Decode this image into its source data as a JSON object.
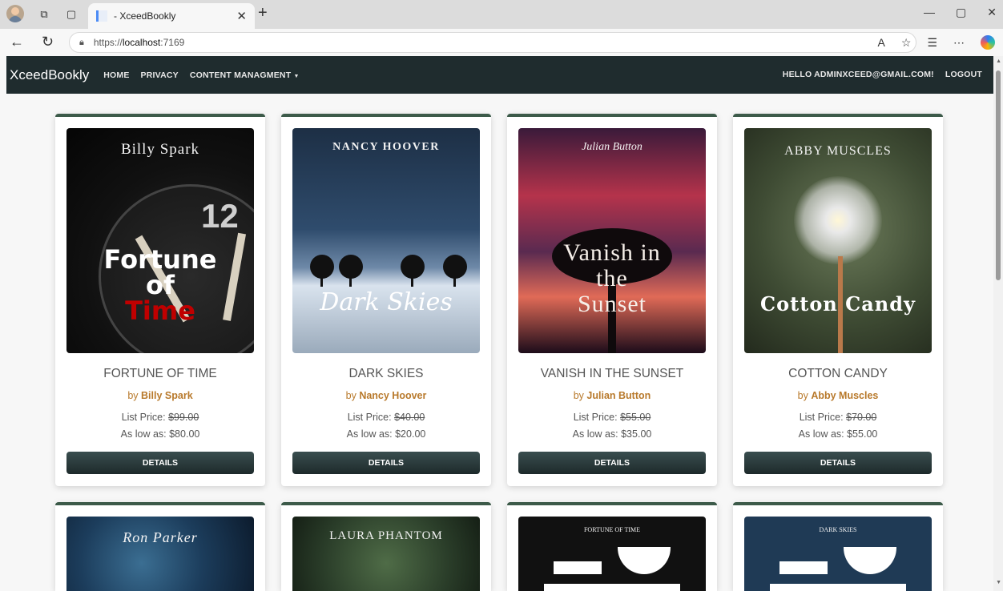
{
  "browser": {
    "tab_title": "- XceedBookly",
    "url_scheme": "https://",
    "url_host": "localhost",
    "url_port": ":7169"
  },
  "navbar": {
    "brand": "XceedBookly",
    "links": [
      "HOME",
      "PRIVACY",
      "CONTENT MANAGMENT"
    ],
    "greeting": "HELLO ADMINXCEED@GMAIL.COM!",
    "logout": "LOGOUT"
  },
  "ui": {
    "by": "by",
    "list_price_label": "List Price:",
    "as_low_as_label": "As low as:",
    "details": "DETAILS"
  },
  "books": [
    {
      "title": "FORTUNE OF TIME",
      "author": "Billy Spark",
      "list_price": "$99.00",
      "low_price": "$80.00",
      "cover_author": "Billy Spark",
      "cover_title_lines": [
        "Fortune",
        "of",
        "Time"
      ]
    },
    {
      "title": "DARK SKIES",
      "author": "Nancy Hoover",
      "list_price": "$40.00",
      "low_price": "$20.00",
      "cover_author": "NANCY HOOVER",
      "cover_title_lines": [
        "Dark Skies"
      ]
    },
    {
      "title": "VANISH IN THE SUNSET",
      "author": "Julian Button",
      "list_price": "$55.00",
      "low_price": "$35.00",
      "cover_author": "Julian Button",
      "cover_title_lines": [
        "Vanish in",
        "the",
        "Sunset"
      ]
    },
    {
      "title": "COTTON CANDY",
      "author": "Abby Muscles",
      "list_price": "$70.00",
      "low_price": "$55.00",
      "cover_author": "ABBY MUSCLES",
      "cover_title_lines": [
        "Cotton Candy"
      ]
    }
  ],
  "partial_covers": [
    {
      "cover_author": "Ron Parker"
    },
    {
      "cover_author": "LAURA PHANTOM"
    },
    {
      "cover_author": "FORTUNE OF TIME"
    },
    {
      "cover_author": "DARK SKIES"
    }
  ],
  "colors": {
    "navbar_bg": "#1f2c2e",
    "author_link": "#b8792b",
    "card_top_border": "#3c5a49"
  }
}
